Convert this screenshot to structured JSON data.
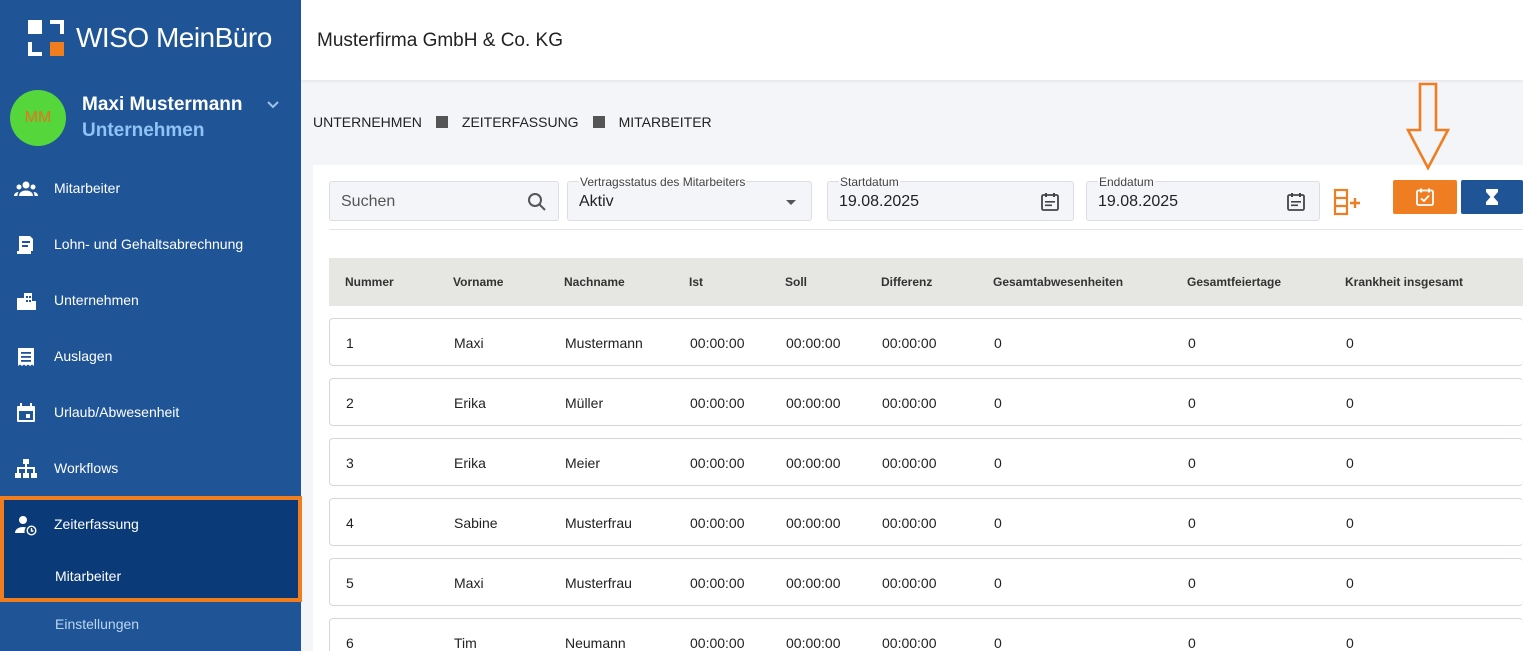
{
  "app": {
    "logo_text": "WISO MeinBüro",
    "company": "Musterfirma GmbH & Co. KG"
  },
  "user": {
    "initials": "MM",
    "name": "Maxi Mustermann",
    "role": "Unternehmen"
  },
  "sidebar": {
    "items": [
      {
        "label": "Mitarbeiter",
        "icon": "people-icon"
      },
      {
        "label": "Lohn- und Gehaltsabrechnung",
        "icon": "payroll-icon"
      },
      {
        "label": "Unternehmen",
        "icon": "building-icon"
      },
      {
        "label": "Auslagen",
        "icon": "receipt-icon"
      },
      {
        "label": "Urlaub/Abwesenheit",
        "icon": "calendar-icon"
      },
      {
        "label": "Workflows",
        "icon": "sitemap-icon"
      },
      {
        "label": "Zeiterfassung",
        "icon": "user-clock-icon"
      }
    ],
    "sub_items": [
      {
        "label": "Mitarbeiter",
        "active": true
      },
      {
        "label": "Einstellungen",
        "active": false
      }
    ]
  },
  "breadcrumb": [
    "UNTERNEHMEN",
    "ZEITERFASSUNG",
    "MITARBEITER"
  ],
  "filters": {
    "search_placeholder": "Suchen",
    "status_label": "Vertragsstatus des Mitarbeiters",
    "status_value": "Aktiv",
    "start_label": "Startdatum",
    "start_value": "19.08.2025",
    "end_label": "Enddatum",
    "end_value": "19.08.2025"
  },
  "colors": {
    "sidebar": "#1f5496",
    "accent": "#ef7d22",
    "active_nav": "#0b3a78"
  },
  "table": {
    "headers": [
      "Nummer",
      "Vorname",
      "Nachname",
      "Ist",
      "Soll",
      "Differenz",
      "Gesamtabwesenheiten",
      "Gesamtfeiertage",
      "Krankheit insgesamt"
    ],
    "rows": [
      [
        "1",
        "Maxi",
        "Mustermann",
        "00:00:00",
        "00:00:00",
        "00:00:00",
        "0",
        "0",
        "0"
      ],
      [
        "2",
        "Erika",
        "Müller",
        "00:00:00",
        "00:00:00",
        "00:00:00",
        "0",
        "0",
        "0"
      ],
      [
        "3",
        "Erika",
        "Meier",
        "00:00:00",
        "00:00:00",
        "00:00:00",
        "0",
        "0",
        "0"
      ],
      [
        "4",
        "Sabine",
        "Musterfrau",
        "00:00:00",
        "00:00:00",
        "00:00:00",
        "0",
        "0",
        "0"
      ],
      [
        "5",
        "Maxi",
        "Musterfrau",
        "00:00:00",
        "00:00:00",
        "00:00:00",
        "0",
        "0",
        "0"
      ],
      [
        "6",
        "Tim",
        "Neumann",
        "00:00:00",
        "00:00:00",
        "00:00:00",
        "0",
        "0",
        "0"
      ]
    ]
  }
}
